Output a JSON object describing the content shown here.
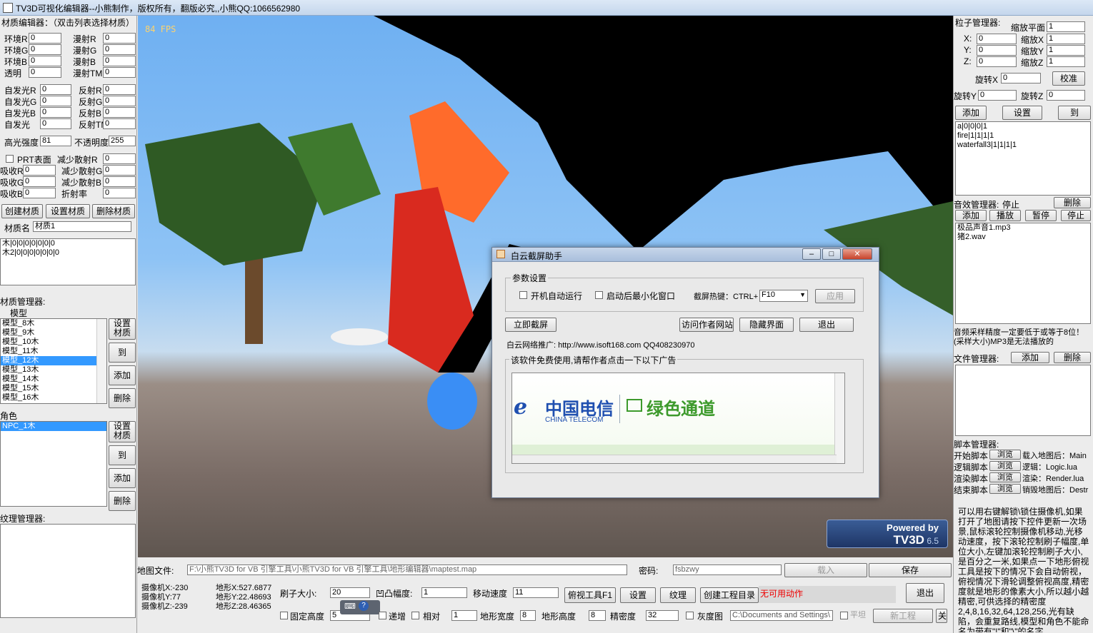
{
  "window": {
    "title": "TV3D可视化编辑器--小熊制作，版权所有，翻版必究,,小熊QQ:1066562980"
  },
  "material_editor": {
    "header": "材质编辑器：（双击列表选择材质）",
    "rows": [
      {
        "l1": "环境R",
        "v1": "0",
        "l2": "漫射R",
        "v2": "0"
      },
      {
        "l1": "环境G",
        "v1": "0",
        "l2": "漫射G",
        "v2": "0"
      },
      {
        "l1": "环境B",
        "v1": "0",
        "l2": "漫射B",
        "v2": "0"
      },
      {
        "l1": "透明",
        "v1": "0",
        "l2": "漫射TM",
        "v2": "0"
      },
      {
        "l1": "自发光R",
        "v1": "0",
        "l2": "反射R",
        "v2": "0"
      },
      {
        "l1": "自发光G",
        "v1": "0",
        "l2": "反射G",
        "v2": "0"
      },
      {
        "l1": "自发光B",
        "v1": "0",
        "l2": "反射B",
        "v2": "0"
      },
      {
        "l1": "自发光",
        "v1": "0",
        "l2": "反射TM",
        "v2": "0"
      }
    ],
    "highlight_label": "高光强度",
    "highlight_value": "81",
    "opacity_label": "不透明度",
    "opacity_value": "255",
    "prt_label": "PRT表面",
    "reduce_scatter_r": "减少散射R",
    "reduce_scatter_r_value": "0",
    "absorb_rows": [
      {
        "l1": "吸收R",
        "v1": "0",
        "l2": "减少散射G",
        "v2": "0"
      },
      {
        "l1": "吸收G",
        "v1": "0",
        "l2": "减少散射B",
        "v2": "0"
      },
      {
        "l1": "吸收B",
        "v1": "0",
        "l2": "折射率",
        "v2": "0"
      }
    ],
    "btn_create": "创建材质",
    "btn_set": "设置材质",
    "btn_delete": "删除材质",
    "name_label": "材质名",
    "name_value": "材质1",
    "list": [
      "木|0|0|0|0|0|0|0",
      "木2|0|0|0|0|0|0|0"
    ]
  },
  "material_manager": {
    "header": "材质管理器:",
    "column": "模型",
    "models": [
      "模型_8木",
      "模型_9木",
      "模型_10木",
      "模型_11木",
      "模型_12木",
      "模型_13木",
      "模型_14木",
      "模型_15木",
      "模型_16木"
    ],
    "selected_index": 4,
    "btn_set": "设置材质",
    "btn_goto": "到",
    "btn_add": "添加",
    "btn_delete": "删除"
  },
  "role": {
    "header": "角色",
    "items": [
      "NPC_1木"
    ],
    "btn_set": "设置材质",
    "btn_goto": "到",
    "btn_add": "添加",
    "btn_delete": "删除"
  },
  "texture_manager": {
    "header": "纹理管理器:"
  },
  "viewport": {
    "fps": "84 FPS",
    "powered_by": "Powered by",
    "engine": "TV3D",
    "version": "6.5"
  },
  "dialog": {
    "title": "白云截屏助手",
    "group_params": "参数设置",
    "autorun": "开机自动运行",
    "minimize": "启动后最小化窗口",
    "hotkey_label": "截屏热键：CTRL+",
    "hotkey_value": "F10",
    "apply": "应用",
    "capture": "立即截屏",
    "visit": "访问作者网站",
    "hide": "隐藏界面",
    "exit": "退出",
    "promo": "白云网络推广: http://www.isoft168.com  QQ408230970",
    "free_note": "该软件免费使用,请帮作者点击一下以下广告",
    "ad_cn": "中国电信",
    "ad_en": "CHINA TELECOM",
    "ad_green": "绿色通道"
  },
  "particle_manager": {
    "header": "粒子管理器:",
    "scale_plane_label": "缩放平面",
    "scale_plane_value": "1",
    "x_label": "X:",
    "x_value": "0",
    "sx_label": "缩放X",
    "sx_value": "1",
    "y_label": "Y:",
    "y_value": "0",
    "sy_label": "缩放Y",
    "sy_value": "1",
    "z_label": "Z:",
    "z_value": "0",
    "sz_label": "缩放Z",
    "sz_value": "1",
    "rx_label": "旋转X",
    "rx_value": "0",
    "calibrate": "校准",
    "ry_label": "旋转Y",
    "ry_value": "0",
    "rz_label": "旋转Z",
    "rz_value": "0",
    "btn_add": "添加",
    "btn_set": "设置",
    "btn_goto": "到",
    "list": [
      "a|0|0|0|1",
      "fire|1|1|1|1",
      "waterfall3|1|1|1|1"
    ]
  },
  "sound_manager": {
    "header": "音效管理器:",
    "stop_label": "停止",
    "btn_delete": "删除",
    "btn_add": "添加",
    "btn_play": "播放",
    "btn_pause": "暂停",
    "btn_stop": "停止",
    "list": [
      "极品声音1.mp3",
      "猪2.wav"
    ],
    "note": "音频采样精度一定要低于或等于8位！(采样大小)MP3是无法播放的"
  },
  "file_manager": {
    "header": "文件管理器:",
    "btn_add": "添加",
    "btn_delete": "删除"
  },
  "script_manager": {
    "header": "脚本管理器:",
    "rows": [
      {
        "label": "开始脚本",
        "browse": "浏览",
        "desc": "载入地图后：Main"
      },
      {
        "label": "逻辑脚本",
        "browse": "浏览",
        "desc": "逻辑：Logic.lua"
      },
      {
        "label": "渲染脚本",
        "browse": "浏览",
        "desc": "渲染：Render.lua"
      },
      {
        "label": "结束脚本",
        "browse": "浏览",
        "desc": "销毁地图后：Destr"
      }
    ],
    "help": "可以用右键解锁\\锁住摄像机,如果打开了地图请按下控件更新一次场景,鼠标滚轮控制摄像机移动,光移动速度，按下滚轮控制刷子幅度,单位大小,左键加滚轮控制刷子大小,是百分之一米,如果点一下地形俯视工具是按下的情况下会自动俯视，俯视情况下滑轮调整俯视高度,精密度就是地形的像素大小,所以越小越精密,可供选择的精密度2,4,8,16,32,64,128,256,光有缺陷，会重复路线,模型和角色不能命名为带有\"|\"和\"\\\"的名字"
  },
  "bottom": {
    "map_file_label": "地图文件:",
    "map_file_value": "F:\\小熊TV3D for VB 引擎工具\\小熊TV3D for VB 引擎工具\\地形编辑器\\maptest.map",
    "password_label": "密码:",
    "password_value": "fsbzwy",
    "load": "载入",
    "save": "保存",
    "cam_x": "摄像机X:-230",
    "cam_y": "摄像机Y:77",
    "cam_z": "摄像机Z:-239",
    "ter_x": "地形X:527.6877",
    "ter_y": "地形Y:22.48693",
    "ter_z": "地形Z:28.46365",
    "brush_label": "刷子大小:",
    "brush_value": "20",
    "bump_label": "凹凸幅度:",
    "bump_value": "1",
    "speed_label": "移动速度",
    "speed_value": "11",
    "topview": "俯视工具F1",
    "settings": "设置",
    "texture": "纹理",
    "create_dir": "创建工程目录",
    "status": "无可用动作",
    "exit": "退出",
    "fixed_height": "固定高度",
    "fixed_value": "5",
    "increment": "递增",
    "relative": "相对",
    "rel_value": "1",
    "width_label": "地形宽度",
    "width_value": "8",
    "height_label": "地形高度",
    "height_value": "8",
    "precision_label": "精密度",
    "precision_value": "32",
    "grayscale": "灰度图",
    "gray_path": "C:\\Documents and Settings\\",
    "smooth": "平坦",
    "new_project": "新工程",
    "about": "关于"
  }
}
